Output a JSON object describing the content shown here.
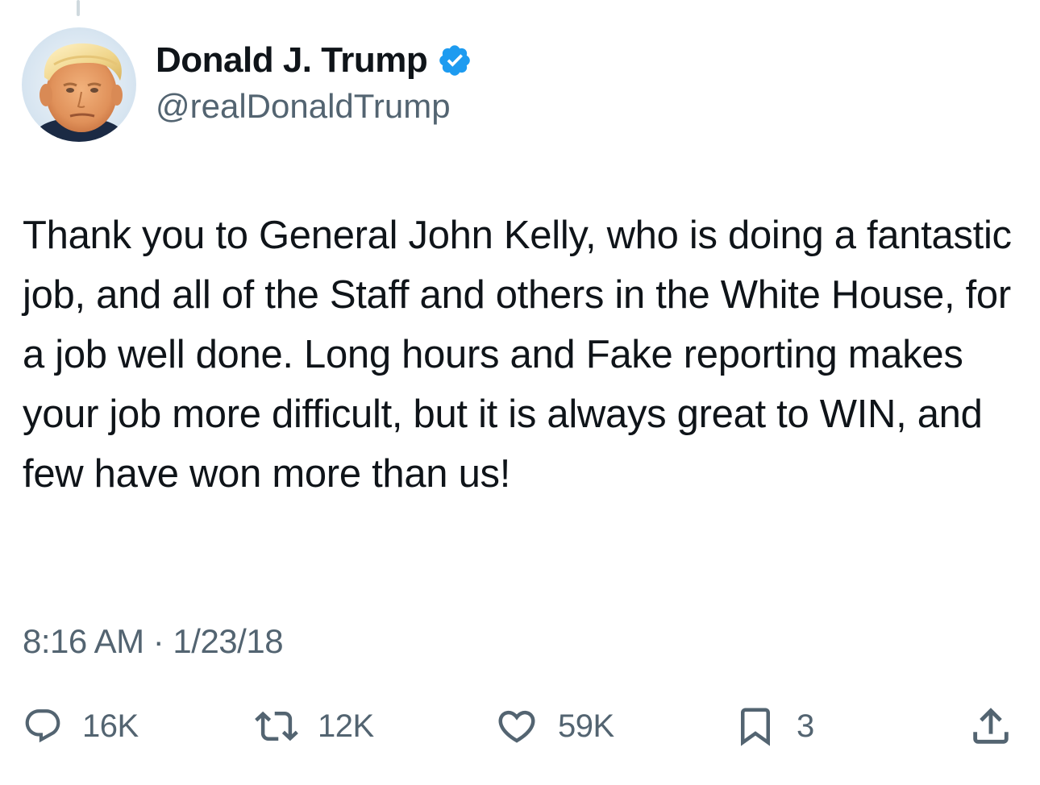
{
  "author": {
    "display_name": "Donald J. Trump",
    "handle": "@realDonaldTrump",
    "verified": true,
    "verified_color": "#1d9bf0"
  },
  "tweet": {
    "text": "Thank you to General John Kelly, who is doing a fantastic job, and all of the Staff and others in the White House, for a job well done. Long hours and Fake reporting makes your job more difficult, but it is always great to WIN, and few have won more than us!",
    "timestamp": "8:16 AM · 1/23/18"
  },
  "actions": {
    "replies": "16K",
    "retweets": "12K",
    "likes": "59K",
    "bookmarks": "3"
  },
  "icons": {
    "reply": "reply-bubble-icon",
    "retweet": "retweet-arrows-icon",
    "like": "heart-icon",
    "bookmark": "bookmark-icon",
    "share": "share-upload-icon",
    "verified": "verified-badge-icon"
  },
  "colors": {
    "text_primary": "#0f1419",
    "text_secondary": "#536471",
    "accent": "#1d9bf0"
  }
}
